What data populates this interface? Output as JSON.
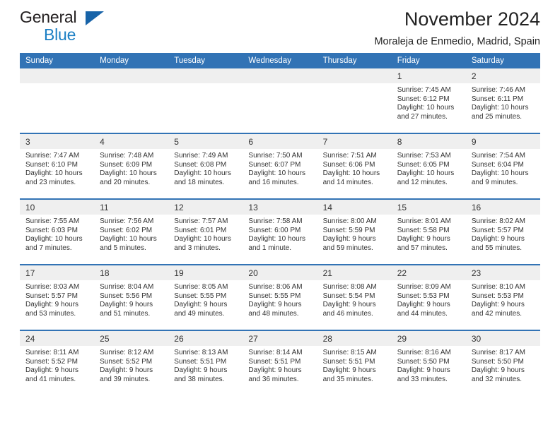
{
  "logo": {
    "word_one": "General",
    "word_two": "Blue",
    "triangle_color": "#1763a8",
    "blue_color": "#1b7fc4"
  },
  "header": {
    "title": "November 2024",
    "subtitle": "Moraleja de Enmedio, Madrid, Spain"
  },
  "theme": {
    "header_blue": "#3273b5",
    "daynum_gray": "#efefef",
    "text": "#333333"
  },
  "weekday_headers": [
    "Sunday",
    "Monday",
    "Tuesday",
    "Wednesday",
    "Thursday",
    "Friday",
    "Saturday"
  ],
  "weeks": [
    {
      "days": [
        {
          "num": "",
          "sunrise": "",
          "sunset": "",
          "daylight1": "",
          "daylight2": "",
          "empty": true
        },
        {
          "num": "",
          "sunrise": "",
          "sunset": "",
          "daylight1": "",
          "daylight2": "",
          "empty": true
        },
        {
          "num": "",
          "sunrise": "",
          "sunset": "",
          "daylight1": "",
          "daylight2": "",
          "empty": true
        },
        {
          "num": "",
          "sunrise": "",
          "sunset": "",
          "daylight1": "",
          "daylight2": "",
          "empty": true
        },
        {
          "num": "",
          "sunrise": "",
          "sunset": "",
          "daylight1": "",
          "daylight2": "",
          "empty": true
        },
        {
          "num": "1",
          "sunrise": "Sunrise: 7:45 AM",
          "sunset": "Sunset: 6:12 PM",
          "daylight1": "Daylight: 10 hours",
          "daylight2": "and 27 minutes.",
          "empty": false
        },
        {
          "num": "2",
          "sunrise": "Sunrise: 7:46 AM",
          "sunset": "Sunset: 6:11 PM",
          "daylight1": "Daylight: 10 hours",
          "daylight2": "and 25 minutes.",
          "empty": false
        }
      ]
    },
    {
      "days": [
        {
          "num": "3",
          "sunrise": "Sunrise: 7:47 AM",
          "sunset": "Sunset: 6:10 PM",
          "daylight1": "Daylight: 10 hours",
          "daylight2": "and 23 minutes.",
          "empty": false
        },
        {
          "num": "4",
          "sunrise": "Sunrise: 7:48 AM",
          "sunset": "Sunset: 6:09 PM",
          "daylight1": "Daylight: 10 hours",
          "daylight2": "and 20 minutes.",
          "empty": false
        },
        {
          "num": "5",
          "sunrise": "Sunrise: 7:49 AM",
          "sunset": "Sunset: 6:08 PM",
          "daylight1": "Daylight: 10 hours",
          "daylight2": "and 18 minutes.",
          "empty": false
        },
        {
          "num": "6",
          "sunrise": "Sunrise: 7:50 AM",
          "sunset": "Sunset: 6:07 PM",
          "daylight1": "Daylight: 10 hours",
          "daylight2": "and 16 minutes.",
          "empty": false
        },
        {
          "num": "7",
          "sunrise": "Sunrise: 7:51 AM",
          "sunset": "Sunset: 6:06 PM",
          "daylight1": "Daylight: 10 hours",
          "daylight2": "and 14 minutes.",
          "empty": false
        },
        {
          "num": "8",
          "sunrise": "Sunrise: 7:53 AM",
          "sunset": "Sunset: 6:05 PM",
          "daylight1": "Daylight: 10 hours",
          "daylight2": "and 12 minutes.",
          "empty": false
        },
        {
          "num": "9",
          "sunrise": "Sunrise: 7:54 AM",
          "sunset": "Sunset: 6:04 PM",
          "daylight1": "Daylight: 10 hours",
          "daylight2": "and 9 minutes.",
          "empty": false
        }
      ]
    },
    {
      "days": [
        {
          "num": "10",
          "sunrise": "Sunrise: 7:55 AM",
          "sunset": "Sunset: 6:03 PM",
          "daylight1": "Daylight: 10 hours",
          "daylight2": "and 7 minutes.",
          "empty": false
        },
        {
          "num": "11",
          "sunrise": "Sunrise: 7:56 AM",
          "sunset": "Sunset: 6:02 PM",
          "daylight1": "Daylight: 10 hours",
          "daylight2": "and 5 minutes.",
          "empty": false
        },
        {
          "num": "12",
          "sunrise": "Sunrise: 7:57 AM",
          "sunset": "Sunset: 6:01 PM",
          "daylight1": "Daylight: 10 hours",
          "daylight2": "and 3 minutes.",
          "empty": false
        },
        {
          "num": "13",
          "sunrise": "Sunrise: 7:58 AM",
          "sunset": "Sunset: 6:00 PM",
          "daylight1": "Daylight: 10 hours",
          "daylight2": "and 1 minute.",
          "empty": false
        },
        {
          "num": "14",
          "sunrise": "Sunrise: 8:00 AM",
          "sunset": "Sunset: 5:59 PM",
          "daylight1": "Daylight: 9 hours",
          "daylight2": "and 59 minutes.",
          "empty": false
        },
        {
          "num": "15",
          "sunrise": "Sunrise: 8:01 AM",
          "sunset": "Sunset: 5:58 PM",
          "daylight1": "Daylight: 9 hours",
          "daylight2": "and 57 minutes.",
          "empty": false
        },
        {
          "num": "16",
          "sunrise": "Sunrise: 8:02 AM",
          "sunset": "Sunset: 5:57 PM",
          "daylight1": "Daylight: 9 hours",
          "daylight2": "and 55 minutes.",
          "empty": false
        }
      ]
    },
    {
      "days": [
        {
          "num": "17",
          "sunrise": "Sunrise: 8:03 AM",
          "sunset": "Sunset: 5:57 PM",
          "daylight1": "Daylight: 9 hours",
          "daylight2": "and 53 minutes.",
          "empty": false
        },
        {
          "num": "18",
          "sunrise": "Sunrise: 8:04 AM",
          "sunset": "Sunset: 5:56 PM",
          "daylight1": "Daylight: 9 hours",
          "daylight2": "and 51 minutes.",
          "empty": false
        },
        {
          "num": "19",
          "sunrise": "Sunrise: 8:05 AM",
          "sunset": "Sunset: 5:55 PM",
          "daylight1": "Daylight: 9 hours",
          "daylight2": "and 49 minutes.",
          "empty": false
        },
        {
          "num": "20",
          "sunrise": "Sunrise: 8:06 AM",
          "sunset": "Sunset: 5:55 PM",
          "daylight1": "Daylight: 9 hours",
          "daylight2": "and 48 minutes.",
          "empty": false
        },
        {
          "num": "21",
          "sunrise": "Sunrise: 8:08 AM",
          "sunset": "Sunset: 5:54 PM",
          "daylight1": "Daylight: 9 hours",
          "daylight2": "and 46 minutes.",
          "empty": false
        },
        {
          "num": "22",
          "sunrise": "Sunrise: 8:09 AM",
          "sunset": "Sunset: 5:53 PM",
          "daylight1": "Daylight: 9 hours",
          "daylight2": "and 44 minutes.",
          "empty": false
        },
        {
          "num": "23",
          "sunrise": "Sunrise: 8:10 AM",
          "sunset": "Sunset: 5:53 PM",
          "daylight1": "Daylight: 9 hours",
          "daylight2": "and 42 minutes.",
          "empty": false
        }
      ]
    },
    {
      "days": [
        {
          "num": "24",
          "sunrise": "Sunrise: 8:11 AM",
          "sunset": "Sunset: 5:52 PM",
          "daylight1": "Daylight: 9 hours",
          "daylight2": "and 41 minutes.",
          "empty": false
        },
        {
          "num": "25",
          "sunrise": "Sunrise: 8:12 AM",
          "sunset": "Sunset: 5:52 PM",
          "daylight1": "Daylight: 9 hours",
          "daylight2": "and 39 minutes.",
          "empty": false
        },
        {
          "num": "26",
          "sunrise": "Sunrise: 8:13 AM",
          "sunset": "Sunset: 5:51 PM",
          "daylight1": "Daylight: 9 hours",
          "daylight2": "and 38 minutes.",
          "empty": false
        },
        {
          "num": "27",
          "sunrise": "Sunrise: 8:14 AM",
          "sunset": "Sunset: 5:51 PM",
          "daylight1": "Daylight: 9 hours",
          "daylight2": "and 36 minutes.",
          "empty": false
        },
        {
          "num": "28",
          "sunrise": "Sunrise: 8:15 AM",
          "sunset": "Sunset: 5:51 PM",
          "daylight1": "Daylight: 9 hours",
          "daylight2": "and 35 minutes.",
          "empty": false
        },
        {
          "num": "29",
          "sunrise": "Sunrise: 8:16 AM",
          "sunset": "Sunset: 5:50 PM",
          "daylight1": "Daylight: 9 hours",
          "daylight2": "and 33 minutes.",
          "empty": false
        },
        {
          "num": "30",
          "sunrise": "Sunrise: 8:17 AM",
          "sunset": "Sunset: 5:50 PM",
          "daylight1": "Daylight: 9 hours",
          "daylight2": "and 32 minutes.",
          "empty": false
        }
      ]
    }
  ]
}
